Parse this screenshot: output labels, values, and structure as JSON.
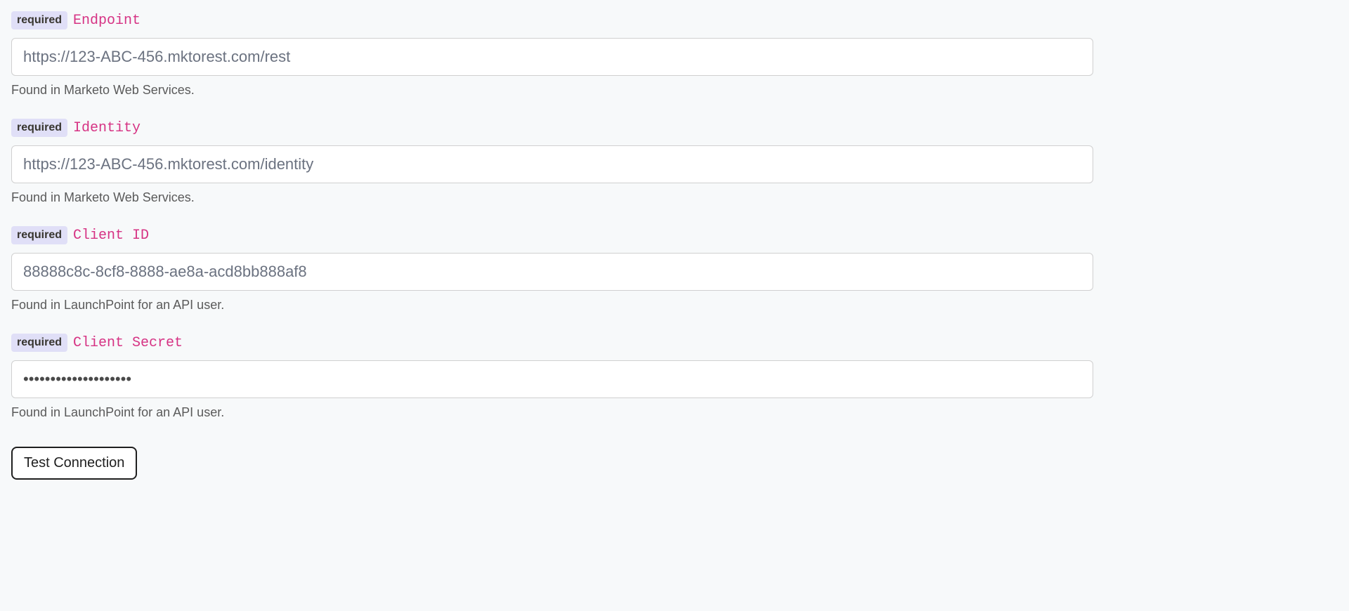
{
  "form": {
    "required_label": "required",
    "fields": {
      "endpoint": {
        "label": "Endpoint",
        "placeholder": "https://123-ABC-456.mktorest.com/rest",
        "value": "",
        "help": "Found in Marketo Web Services."
      },
      "identity": {
        "label": "Identity",
        "placeholder": "https://123-ABC-456.mktorest.com/identity",
        "value": "",
        "help": "Found in Marketo Web Services."
      },
      "client_id": {
        "label": "Client ID",
        "placeholder": "88888c8c-8cf8-8888-ae8a-acd8bb888af8",
        "value": "",
        "help": "Found in LaunchPoint for an API user."
      },
      "client_secret": {
        "label": "Client Secret",
        "value": "••••••••••••••••••••",
        "help": "Found in LaunchPoint for an API user."
      }
    },
    "test_button": "Test Connection"
  }
}
